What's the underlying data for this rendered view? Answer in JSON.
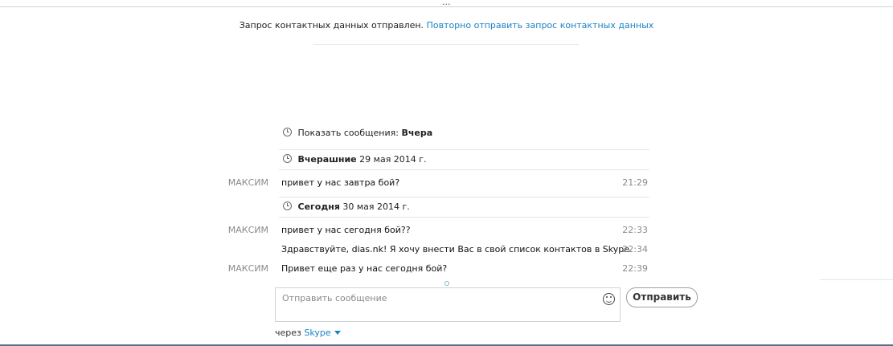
{
  "notice": {
    "text": "Запрос контактных данных отправлен.",
    "link": "Повторно отправить запрос контактных данных"
  },
  "history": {
    "show_label": "Показать сообщения:",
    "show_value": "Вчера"
  },
  "days": [
    {
      "label": "Вчерашние",
      "date": "29 мая 2014 г."
    },
    {
      "label": "Сегодня",
      "date": "30 мая 2014 г."
    }
  ],
  "messages": [
    {
      "sender": "МАКСИМ",
      "text": "привет у нас завтра бой?",
      "time": "21:29"
    },
    {
      "sender": "МАКСИМ",
      "text": "привет у нас сегодня бой??",
      "time": "22:33"
    },
    {
      "sender": "",
      "text": "Здравствуйте, dias.nk! Я хочу внести Вас в свой список контактов в Skype.",
      "time": "22:34"
    },
    {
      "sender": "МАКСИМ",
      "text": "Привет еще раз у нас сегодня бой?",
      "time": "22:39"
    }
  ],
  "composer": {
    "placeholder": "Отправить сообщение",
    "send_label": "Отправить",
    "via_label": "через",
    "via_service": "Skype"
  },
  "top": {
    "dots": "..."
  }
}
